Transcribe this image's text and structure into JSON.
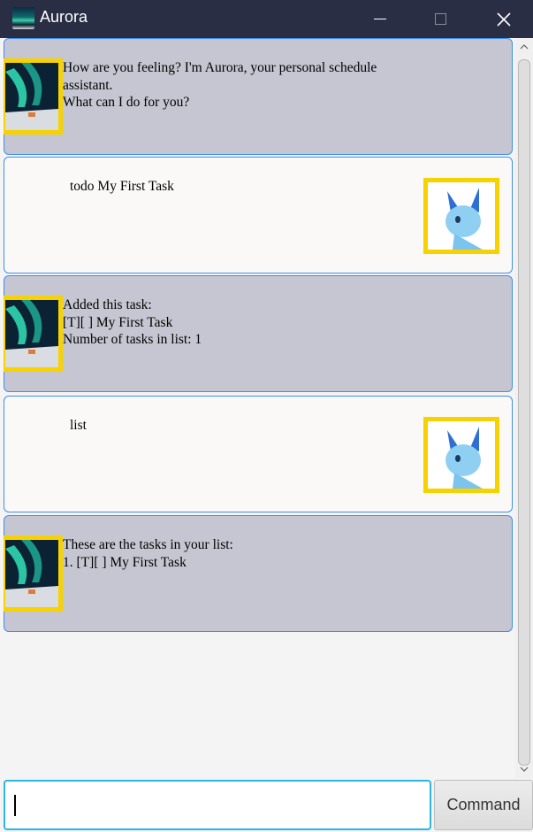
{
  "window": {
    "title": "Aurora",
    "icon": "aurora-app-icon",
    "controls": [
      "minimize",
      "maximize",
      "close"
    ]
  },
  "messages": [
    {
      "sender": "bot",
      "text": "How are you feeling? I'm Aurora, your personal schedule\nassistant.\nWhat can I do for you?",
      "avatar": "aurora-night-sky-avatar"
    },
    {
      "sender": "user",
      "text": "todo My First Task",
      "avatar": "blue-pokemon-avatar"
    },
    {
      "sender": "bot",
      "text": "Added this task:\n[T][ ] My First Task\nNumber of tasks in list: 1",
      "avatar": "aurora-night-sky-avatar"
    },
    {
      "sender": "user",
      "text": "list",
      "avatar": "blue-pokemon-avatar"
    },
    {
      "sender": "bot",
      "text": "These are the tasks in your list:\n1. [T][ ] My First Task",
      "avatar": "aurora-night-sky-avatar"
    }
  ],
  "input": {
    "value": "",
    "placeholder": ""
  },
  "command_button": {
    "label": "Command"
  },
  "colors": {
    "titlebar": "#2a2e44",
    "bot_bubble": "#c6c6d2",
    "user_bubble": "#fbf9f7",
    "bubble_border": "#3d8ef0",
    "avatar_frame": "#f7d100",
    "input_border": "#2bb6e6"
  }
}
